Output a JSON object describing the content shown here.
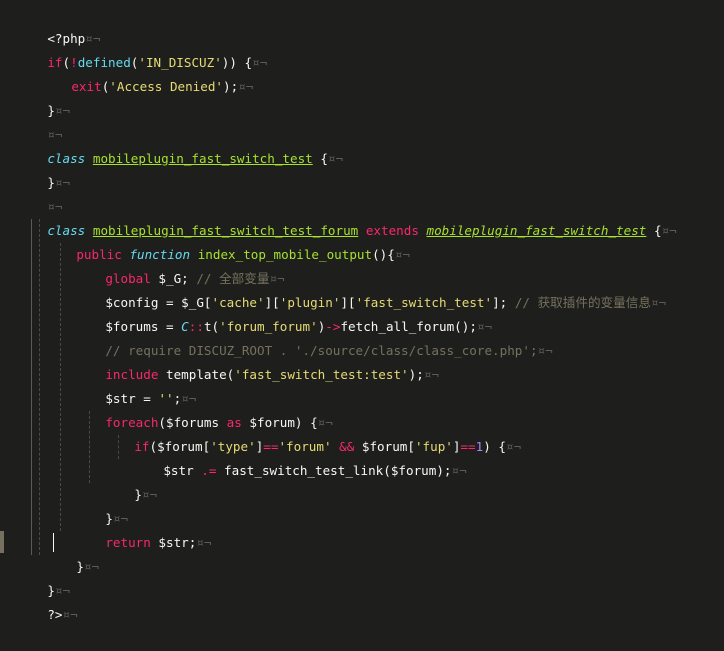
{
  "editor": {
    "language": "php",
    "lines": [
      "<?php",
      "if(!defined('IN_DISCUZ')) {",
      "    exit('Access Denied');",
      "}",
      "",
      "class mobileplugin_fast_switch_test {",
      "}",
      "",
      "class mobileplugin_fast_switch_test_forum extends mobileplugin_fast_switch_test {",
      "    public function index_top_mobile_output(){",
      "        global $_G; // 全部变量",
      "        $config = $_G['cache']['plugin']['fast_switch_test']; // 获取插件的变量信息",
      "        $forums = C::t('forum_forum')->fetch_all_forum();",
      "        // require DISCUZ_ROOT . './source/class/class_core.php';",
      "        include template('fast_switch_test:test');",
      "        $str = '';",
      "        foreach($forums as $forum) {",
      "            if($forum['type']=='forum' && $forum['fup']==1) {",
      "                $str .= fast_switch_test_link($forum);",
      "            }",
      "        }",
      "        return $str;",
      "    }",
      "}",
      "?>"
    ]
  },
  "colors": {
    "background": "#1e1f1c",
    "keyword": "#f92672",
    "string": "#e6db74",
    "comment": "#75715e",
    "function": "#a6e22e",
    "storage": "#66d9ef",
    "number": "#ae81ff"
  },
  "tokens": {
    "l0": {
      "t0": "<?php"
    },
    "l1": {
      "t0": "if",
      "t1": "(",
      "t2": "!",
      "t3": "defined",
      "t4": "(",
      "t5": "'IN_DISCUZ'",
      "t6": ")) {"
    },
    "l2": {
      "t0": "exit",
      "t1": "(",
      "t2": "'Access Denied'",
      "t3": ");"
    },
    "l3": {
      "t0": "}"
    },
    "l5": {
      "t0": "class",
      "t1": "mobileplugin_fast_switch_test",
      "t2": " {"
    },
    "l6": {
      "t0": "}"
    },
    "l8": {
      "t0": "class",
      "t1": "mobileplugin_fast_switch_test_forum",
      "t2": "extends",
      "t3": "mobileplugin_fast_switch_test",
      "t4": " {"
    },
    "l9": {
      "t0": "public",
      "t1": "function",
      "t2": "index_top_mobile_output",
      "t3": "(){"
    },
    "l10": {
      "t0": "global",
      "t1": " $_G; ",
      "t2": "// 全部变量"
    },
    "l11": {
      "t0": "$config",
      "t1": " = ",
      "t2": "$_G",
      "t3": "[",
      "t4": "'cache'",
      "t5": "][",
      "t6": "'plugin'",
      "t7": "][",
      "t8": "'fast_switch_test'",
      "t9": "]; ",
      "t10": "// 获取插件的变量信息"
    },
    "l12": {
      "t0": "$forums",
      "t1": " = ",
      "t2": "C",
      "t3": "::",
      "t4": "t(",
      "t5": "'forum_forum'",
      "t6": ")",
      "t7": "->",
      "t8": "fetch_all_forum();"
    },
    "l13": {
      "t0": "// require DISCUZ_ROOT . './source/class/class_core.php';"
    },
    "l14": {
      "t0": "include",
      "t1": " template(",
      "t2": "'fast_switch_test:test'",
      "t3": ");"
    },
    "l15": {
      "t0": "$str",
      "t1": " = ",
      "t2": "''",
      "t3": ";"
    },
    "l16": {
      "t0": "foreach",
      "t1": "($forums ",
      "t2": "as",
      "t3": " $forum) {"
    },
    "l17": {
      "t0": "if",
      "t1": "($forum[",
      "t2": "'type'",
      "t3": "]",
      "t4": "==",
      "t5": "'forum'",
      "t6": " && ",
      "t7": "$forum[",
      "t8": "'fup'",
      "t9": "]",
      "t10": "==",
      "t11": "1",
      "t12": ") {"
    },
    "l18": {
      "t0": "$str",
      "t1": " .= ",
      "t2": "fast_switch_test_link($forum);"
    },
    "l19": {
      "t0": "}"
    },
    "l20": {
      "t0": "}"
    },
    "l21": {
      "t0": "return",
      "t1": " $str;"
    },
    "l22": {
      "t0": "}"
    },
    "l23": {
      "t0": "}"
    },
    "l24": {
      "t0": "?>"
    }
  },
  "whitespace_marker": "¤¬"
}
